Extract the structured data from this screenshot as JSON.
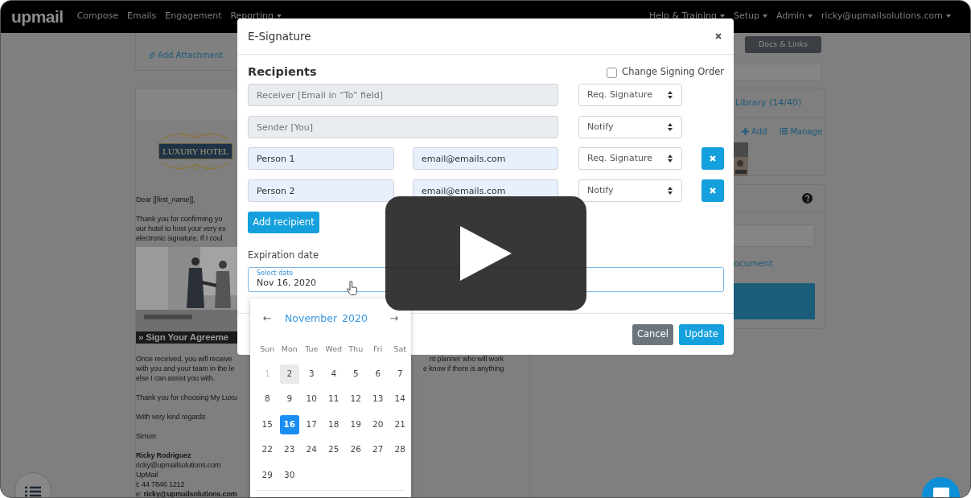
{
  "navbar": {
    "logo": "upmail",
    "links": [
      {
        "label": "Compose",
        "dropdown": false
      },
      {
        "label": "Emails",
        "dropdown": false
      },
      {
        "label": "Engagement",
        "dropdown": false
      },
      {
        "label": "Reporting",
        "dropdown": true
      }
    ],
    "right_links": [
      {
        "label": "Help & Training",
        "dropdown": true
      },
      {
        "label": "Setup",
        "dropdown": true
      },
      {
        "label": "Admin",
        "dropdown": true
      },
      {
        "label": "ricky@upmailsolutions.com",
        "dropdown": true
      }
    ]
  },
  "email_editor": {
    "attachment_link": "Add Attachment",
    "blocks": [
      {
        "kind": "logo",
        "text": "LUXURY HOTEL"
      },
      {
        "kind": "text",
        "lines": [
          {
            "left": "Dear [[first_name]],"
          }
        ]
      },
      {
        "kind": "text",
        "lines": [
          {
            "left": "Thank you for confirming yo"
          },
          {
            "left": "our hotel to host your very ex"
          },
          {
            "left": "electronic signature. If I coul"
          }
        ]
      },
      {
        "kind": "picture"
      },
      {
        "kind": "banner",
        "text": "» Sign Your Agreeme"
      },
      {
        "kind": "text",
        "lines": [
          {
            "left": "Once received, you will receive",
            "right": "nt planner who will work"
          },
          {
            "left": "with you and your team in the le",
            "right": "e know if there is anything"
          },
          {
            "left": "else I can assist you with."
          }
        ]
      },
      {
        "kind": "text",
        "lines": [
          {
            "left": "Thank you for choosing My Luxu"
          }
        ]
      },
      {
        "kind": "text",
        "lines": [
          {
            "left": "With very kind regards"
          }
        ]
      },
      {
        "kind": "text",
        "lines": [
          {
            "left": "Simon"
          }
        ]
      },
      {
        "kind": "text",
        "lines": [
          {
            "left": "Ricky Rodriguez",
            "bold": true
          },
          {
            "left": "ricky@upmailsolutions.com"
          },
          {
            "left": "UpMail"
          },
          {
            "left": "t: 44 7846 1212"
          },
          {
            "left": "e: **ricky@upmailsolutions.com**"
          }
        ]
      }
    ]
  },
  "sidebar": {
    "tab": "Docs & Links",
    "library": {
      "title": "Library (14/40)",
      "actions": [
        {
          "kind": "add",
          "label": "Add"
        },
        {
          "kind": "manage",
          "label": "Manage"
        }
      ]
    },
    "help_panel": {
      "link": "ocument"
    }
  },
  "modal": {
    "title": "E-Signature",
    "heading": "Recipients",
    "change_signing_order": {
      "label": "Change Signing Order",
      "checked": false
    },
    "recipients": [
      {
        "kind": "fixed",
        "name": "Receiver [Email in “To” field]",
        "disabled": true,
        "signature_type": "Req. Signature"
      },
      {
        "kind": "fixed",
        "name": "Sender [You]",
        "disabled": true,
        "signature_type": "Notify"
      },
      {
        "kind": "person",
        "name": "Person 1",
        "email": "email@emails.com",
        "disabled": false,
        "signature_type": "Req. Signature"
      },
      {
        "kind": "person",
        "name": "Person 2",
        "email": "email@emails.com",
        "disabled": false,
        "signature_type": "Notify"
      }
    ],
    "add_button": "Add recipient",
    "expiration": {
      "label": "Expiration date",
      "field_label": "Select date",
      "value": "Nov 16, 2020"
    },
    "buttons": [
      {
        "kind": "secondary",
        "label": "Cancel"
      },
      {
        "kind": "primary",
        "label": "Update"
      }
    ]
  },
  "calendar": {
    "prev": "←",
    "month": "November",
    "year": "2020",
    "next": "→",
    "weekdays": [
      "Sun",
      "Mon",
      "Tue",
      "Wed",
      "Thu",
      "Fri",
      "Sat"
    ],
    "days": [
      {
        "day": "1",
        "disabled": true,
        "today": false,
        "selected": false
      },
      {
        "day": "2",
        "disabled": false,
        "today": true,
        "selected": false
      },
      {
        "day": "3",
        "disabled": false,
        "today": false,
        "selected": false
      },
      {
        "day": "4",
        "disabled": false,
        "today": false,
        "selected": false
      },
      {
        "day": "5",
        "disabled": false,
        "today": false,
        "selected": false
      },
      {
        "day": "6",
        "disabled": false,
        "today": false,
        "selected": false
      },
      {
        "day": "7",
        "disabled": false,
        "today": false,
        "selected": false
      },
      {
        "day": "8",
        "disabled": false,
        "today": false,
        "selected": false
      },
      {
        "day": "9",
        "disabled": false,
        "today": false,
        "selected": false
      },
      {
        "day": "10",
        "disabled": false,
        "today": false,
        "selected": false
      },
      {
        "day": "11",
        "disabled": false,
        "today": false,
        "selected": false
      },
      {
        "day": "12",
        "disabled": false,
        "today": false,
        "selected": false
      },
      {
        "day": "13",
        "disabled": false,
        "today": false,
        "selected": false
      },
      {
        "day": "14",
        "disabled": false,
        "today": false,
        "selected": false
      },
      {
        "day": "15",
        "disabled": false,
        "today": false,
        "selected": false
      },
      {
        "day": "16",
        "disabled": false,
        "today": false,
        "selected": true
      },
      {
        "day": "17",
        "disabled": false,
        "today": false,
        "selected": false
      },
      {
        "day": "18",
        "disabled": false,
        "today": false,
        "selected": false
      },
      {
        "day": "19",
        "disabled": false,
        "today": false,
        "selected": false
      },
      {
        "day": "20",
        "disabled": false,
        "today": false,
        "selected": false
      },
      {
        "day": "21",
        "disabled": false,
        "today": false,
        "selected": false
      },
      {
        "day": "22",
        "disabled": false,
        "today": false,
        "selected": false
      },
      {
        "day": "23",
        "disabled": false,
        "today": false,
        "selected": false
      },
      {
        "day": "24",
        "disabled": false,
        "today": false,
        "selected": false
      },
      {
        "day": "25",
        "disabled": false,
        "today": false,
        "selected": false
      },
      {
        "day": "26",
        "disabled": false,
        "today": false,
        "selected": false
      },
      {
        "day": "27",
        "disabled": false,
        "today": false,
        "selected": false
      },
      {
        "day": "28",
        "disabled": false,
        "today": false,
        "selected": false
      },
      {
        "day": "29",
        "disabled": false,
        "today": false,
        "selected": false
      },
      {
        "day": "30",
        "disabled": false,
        "today": false,
        "selected": false
      }
    ]
  }
}
